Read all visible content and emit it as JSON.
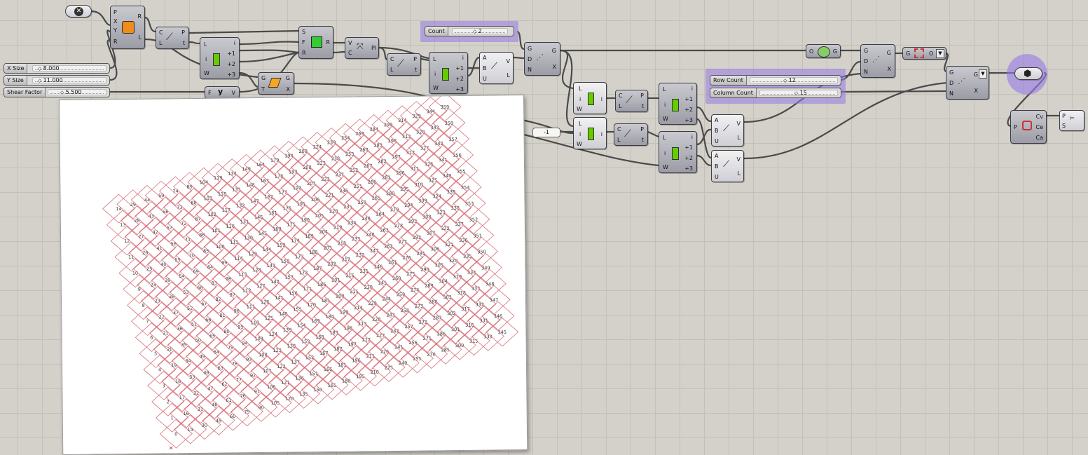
{
  "canvas": {
    "background": "#d4d1ca",
    "grid_color": "#c3c0b8",
    "wire_color": "#4a4a4a",
    "group_color": "#9678e6"
  },
  "sliders": {
    "x_size": {
      "label": "X Size",
      "value": "8.000"
    },
    "y_size": {
      "label": "Y Size",
      "value": "11.000"
    },
    "shear_factor": {
      "label": "Shear Factor",
      "value": "5.500"
    },
    "count": {
      "label": "Count",
      "value": "2"
    },
    "row_count": {
      "label": "Row Count",
      "value": "12"
    },
    "column_count": {
      "label": "Column Count",
      "value": "15"
    }
  },
  "panels": {
    "neg_one": "-1"
  },
  "components": {
    "plane": {
      "in": [
        "P",
        "X",
        "Y",
        "R"
      ],
      "out": [
        "R",
        "L"
      ]
    },
    "evaluate1": {
      "in": [
        "C",
        "L"
      ],
      "out": [
        "P",
        "t"
      ]
    },
    "shift1": {
      "in": [
        "L",
        "i",
        "W"
      ],
      "out": [
        "i",
        "+1",
        "+2",
        "+3"
      ]
    },
    "evaluate2": {
      "in": [
        "G",
        "T"
      ],
      "out": [
        "G",
        "X"
      ]
    },
    "fxy": {
      "in": [
        "F"
      ],
      "out": [
        "V"
      ],
      "label": "y"
    },
    "shear": {
      "in": [
        "S",
        "F",
        "R"
      ],
      "out": [
        "R"
      ]
    },
    "vector": {
      "in": [
        "V",
        "C"
      ],
      "out": [
        "Pl"
      ]
    },
    "evaluate3": {
      "in": [
        "C",
        "L"
      ],
      "out": [
        "P",
        "t"
      ]
    },
    "shift2": {
      "in": [
        "L",
        "i",
        "W"
      ],
      "out": [
        "i",
        "+1",
        "+2",
        "+3"
      ]
    },
    "line1": {
      "in": [
        "A",
        "B",
        "U"
      ],
      "out": [
        "V",
        "L"
      ]
    },
    "array1": {
      "in": [
        "G",
        "D",
        "N"
      ],
      "out": [
        "G",
        "X"
      ]
    },
    "item1": {
      "in": [
        "L",
        "i",
        "W"
      ],
      "out": [
        "i"
      ]
    },
    "item2": {
      "in": [
        "L",
        "i",
        "W"
      ],
      "out": [
        "i"
      ]
    },
    "evaluate4": {
      "in": [
        "C",
        "L"
      ],
      "out": [
        "P",
        "t"
      ]
    },
    "evaluate5": {
      "in": [
        "C",
        "L"
      ],
      "out": [
        "P",
        "t"
      ]
    },
    "shift3": {
      "in": [
        "L",
        "i",
        "W"
      ],
      "out": [
        "i",
        "+1",
        "+2",
        "+3"
      ]
    },
    "shift4": {
      "in": [
        "L",
        "i",
        "W"
      ],
      "out": [
        "i",
        "+1",
        "+2",
        "+3"
      ]
    },
    "line2": {
      "in": [
        "A",
        "B",
        "U"
      ],
      "out": [
        "V",
        "L"
      ]
    },
    "line3": {
      "in": [
        "A",
        "B",
        "U"
      ],
      "out": [
        "V",
        "L"
      ]
    },
    "explode": {
      "in": [
        "O"
      ],
      "out": [
        "G"
      ]
    },
    "array2": {
      "in": [
        "G",
        "D",
        "N"
      ],
      "out": [
        "G",
        "X"
      ]
    },
    "boundary": {
      "in": [
        "G"
      ],
      "out": [
        "O"
      ]
    },
    "array3": {
      "in": [
        "G",
        "D",
        "N"
      ],
      "out": [
        "G",
        "X"
      ]
    },
    "area": {
      "in": [
        "P"
      ],
      "out": [
        "Cv",
        "Ce",
        "Ca"
      ]
    },
    "panel_out": {
      "in": [
        "P",
        "S"
      ],
      "out": []
    }
  },
  "grid": {
    "columns": 24,
    "rows": 15,
    "cell_color": "#d9727a",
    "origin_marker_color": "#cc0000"
  }
}
